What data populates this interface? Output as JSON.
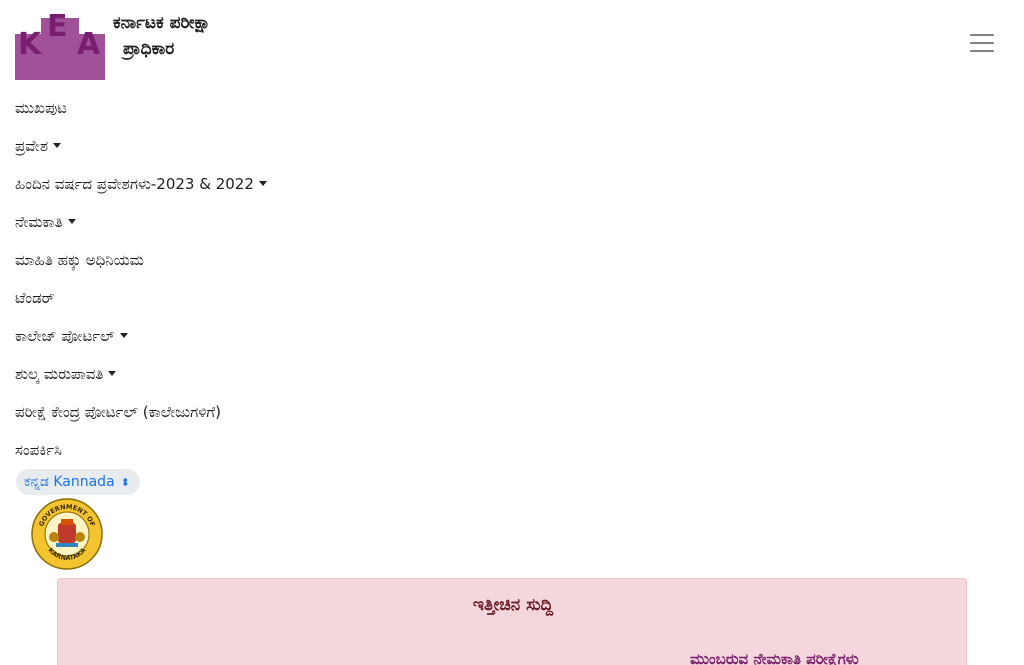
{
  "header": {
    "logo_letters": [
      "K",
      "E",
      "A"
    ],
    "org_line1": "ಕರ್ನಾಟಕ ಪರೀಕ್ಷಾ",
    "org_line2": "ಪ್ರಾಧಿಕಾರ",
    "menu_icon": "hamburger-menu-icon"
  },
  "nav": {
    "items": [
      {
        "label": "ಮುಖಪುಟ",
        "dropdown": false
      },
      {
        "label": "ಪ್ರವೇಶ",
        "dropdown": true
      },
      {
        "label": "ಹಿಂದಿನ ವರ್ಷದ ಪ್ರವೇಶಗಳು-2023 & 2022",
        "dropdown": true
      },
      {
        "label": "ನೇಮಕಾತಿ",
        "dropdown": true
      },
      {
        "label": "ಮಾಹಿತಿ ಹಕ್ಕು ಅಧಿನಿಯಮ",
        "dropdown": false
      },
      {
        "label": "ಟೆಂಡರ್",
        "dropdown": false
      },
      {
        "label": "ಕಾಲೇಜ್ ಪೋರ್ಟಲ್",
        "dropdown": true
      },
      {
        "label": "ಶುಲ್ಕ ಮರುಪಾವತಿ",
        "dropdown": true
      },
      {
        "label": "ಪರೀಕ್ಷೆ ಕೇಂದ್ರ ಪೋರ್ಟಲ್ (ಕಾಲೇಜುಗಳಿಗೆ)",
        "dropdown": false
      },
      {
        "label": "ಸಂಪರ್ಕಿಸಿ",
        "dropdown": false
      }
    ]
  },
  "language": {
    "selected": "ಕನ್ನಡ Kannada"
  },
  "emblem": {
    "top_text": "GOVERNMENT OF",
    "bottom_text": "KARNATAKA"
  },
  "news": {
    "title": "ಇತ್ತೀಚಿನ ಸುದ್ದಿ",
    "subtitle": "ಮುಂಬರುವ ನೇಮಕಾತಿ ಪರೀಕ್ಷೆಗಳು"
  },
  "colors": {
    "logo_purple": "#a0519a",
    "logo_text": "#7a1f70",
    "news_bg": "#f4d7dc",
    "news_title": "#6b1a24",
    "link_blue": "#1a73e8"
  }
}
